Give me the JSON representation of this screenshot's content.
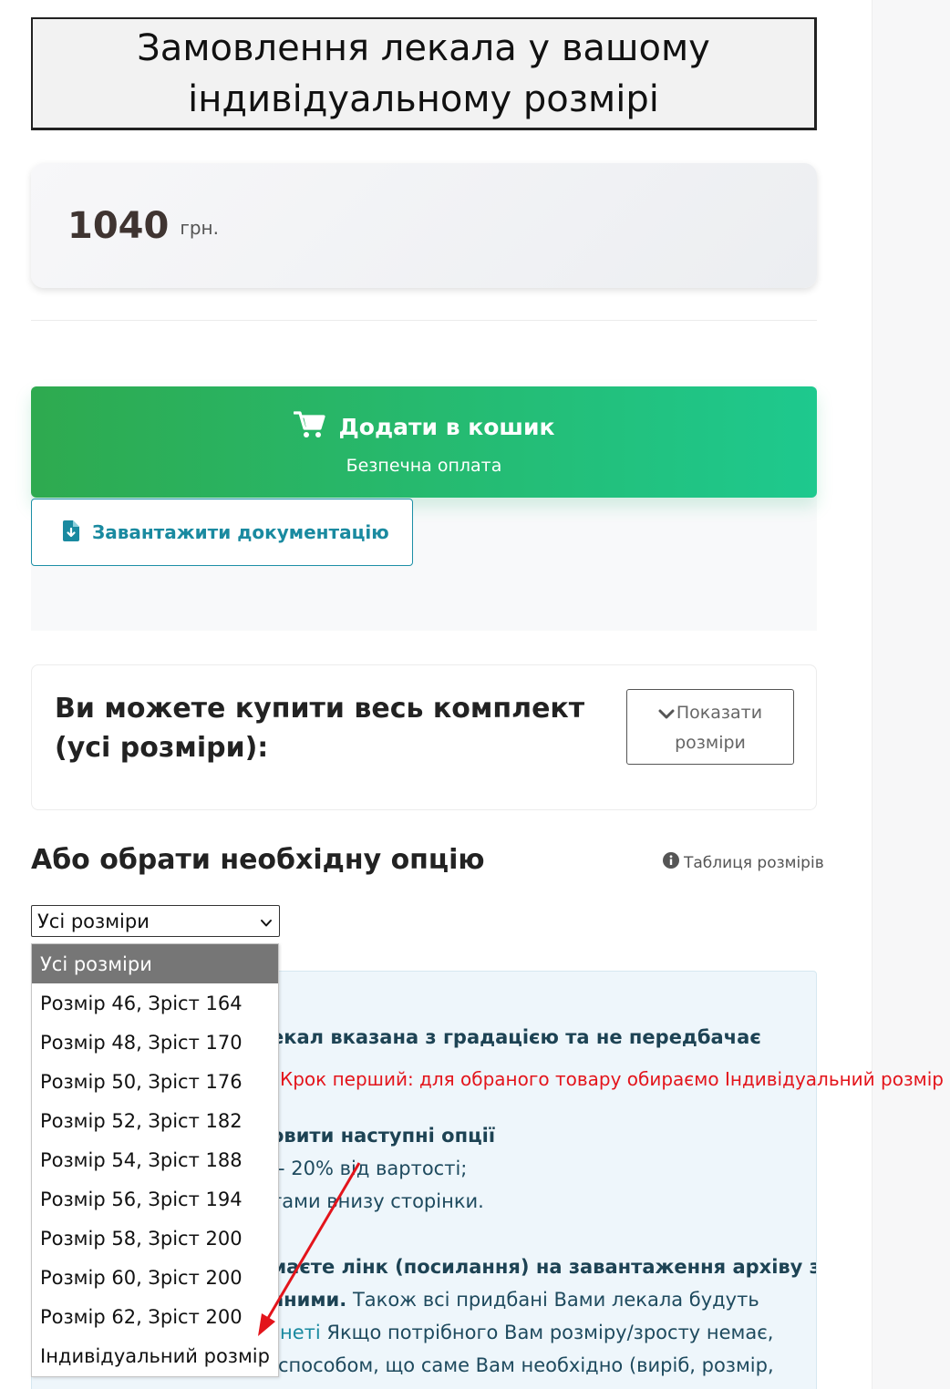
{
  "page": {
    "title": "Замовлення лекала у вашому індивідуальному розмірі"
  },
  "price": {
    "value": "1040",
    "currency": "грн."
  },
  "cart_button": {
    "label": "Додати в кошик",
    "sublabel": "Безпечна оплата",
    "icon": "shopping-cart-icon"
  },
  "doc_button": {
    "label": "Завантажити документацію",
    "icon": "file-download-icon"
  },
  "kit": {
    "title": "Ви можете купити весь комплект (усі розміри):",
    "show_sizes_label": "Показати розміри",
    "icon": "chevron-down-icon"
  },
  "options": {
    "title": "Або обрати необхідну опцію",
    "size_table_label": "Таблиця розмірів",
    "size_table_icon": "info-circle-icon"
  },
  "select": {
    "value": "Усі розміри",
    "options": [
      "Усі розміри",
      "Розмір 46, Зріст 164",
      "Розмір 48, Зріст 170",
      "Розмір 50, Зріст 176",
      "Розмір 52, Зріст 182",
      "Розмір 54, Зріст 188",
      "Розмір 56, Зріст 194",
      "Розмір 58, Зріст 200",
      "Розмір 60, Зріст 200",
      "Розмір 62, Зріст 200",
      "Індивідуальний розмір"
    ],
    "selected_index": 0
  },
  "info_panel": {
    "line1": "екал вказана з градацією та не передбачає",
    "line2": "овити наступні опції",
    "line3": "- 20% від вартості;",
    "line4": "тами внизу сторінки.",
    "line5": "маєте лінк (посилання) на завантаження архіву з",
    "line6_bold": "аними.",
    "line6_rest": " Також всі придбані Вами лекала будуть",
    "line7_link": "неті",
    "line7_rest": " Якщо потрібного Вам розміру/зросту немає,",
    "line8": "способом, що саме Вам необхідно (виріб, розмір,"
  },
  "annotation": {
    "text": "Крок перший: для обраного товару обираємо Індивідуальний розмір",
    "color": "#e3141b"
  },
  "colors": {
    "cart_gradient_start": "#2eaa4f",
    "cart_gradient_end": "#1ec98e",
    "accent_teal": "#1a8aa0",
    "annotation_red": "#e3141b"
  }
}
